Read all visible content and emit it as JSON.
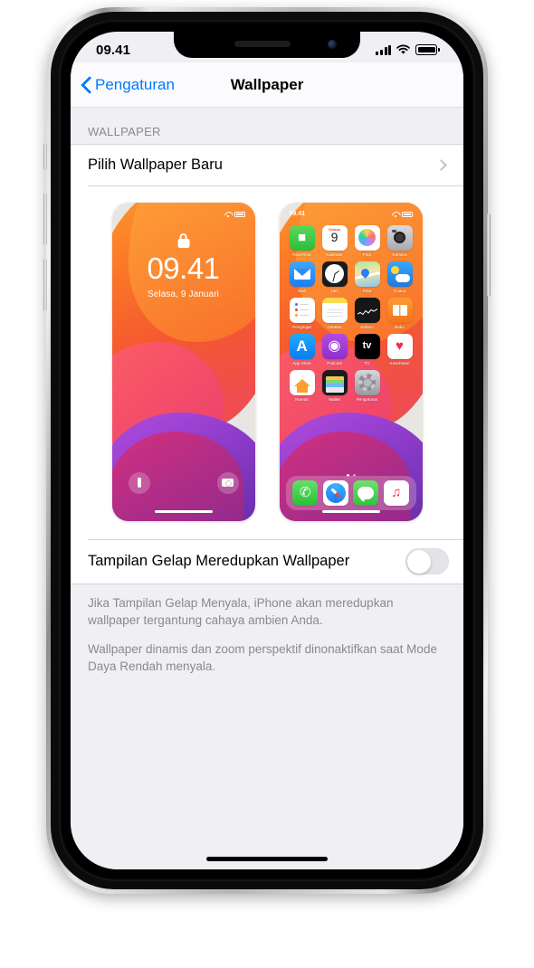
{
  "statusbar": {
    "time": "09.41",
    "signal_icon": "cellular-bars-icon",
    "wifi_icon": "wifi-icon",
    "battery_icon": "battery-icon"
  },
  "navbar": {
    "back_label": "Pengaturan",
    "title": "Wallpaper",
    "back_icon": "chevron-left-icon"
  },
  "section": {
    "header": "WALLPAPER"
  },
  "rows": {
    "choose_wallpaper": {
      "label": "Pilih Wallpaper Baru",
      "chevron_icon": "chevron-right-icon"
    },
    "dark_dim": {
      "label": "Tampilan Gelap Meredupkan Wallpaper",
      "toggle_state": "off"
    }
  },
  "footer": {
    "paragraph_1": "Jika Tampilan Gelap Menyala, iPhone akan meredupkan wallpaper tergantung cahaya ambien Anda.",
    "paragraph_2": "Wallpaper dinamis dan zoom perspektif dinonaktifkan saat Mode Daya Rendah menyala."
  },
  "lock_preview": {
    "lock_icon": "lock-icon",
    "time": "09.41",
    "date": "Selasa, 9 Januari",
    "flashlight_icon": "flashlight-icon",
    "camera_icon": "camera-icon",
    "mini_status": {
      "wifi_icon": "wifi-icon",
      "battery_icon": "battery-icon"
    }
  },
  "home_preview": {
    "mini_status": {
      "time": "09.41",
      "wifi_icon": "wifi-icon",
      "battery_icon": "battery-icon"
    },
    "calendar_weekday": "Selasa",
    "calendar_day": "9",
    "page_dots": 2,
    "active_dot": 1,
    "apps": [
      {
        "label": "FaceTime",
        "icon": "facetime-icon"
      },
      {
        "label": "Kalender",
        "icon": "calendar-icon"
      },
      {
        "label": "Foto",
        "icon": "photos-icon"
      },
      {
        "label": "Kamera",
        "icon": "camera-icon"
      },
      {
        "label": "Mail",
        "icon": "mail-icon"
      },
      {
        "label": "Jam",
        "icon": "clock-icon"
      },
      {
        "label": "Peta",
        "icon": "maps-icon"
      },
      {
        "label": "Cuaca",
        "icon": "weather-icon"
      },
      {
        "label": "Pengingat",
        "icon": "reminders-icon"
      },
      {
        "label": "Catatan",
        "icon": "notes-icon"
      },
      {
        "label": "Saham",
        "icon": "stocks-icon"
      },
      {
        "label": "Buku",
        "icon": "books-icon"
      },
      {
        "label": "App Store",
        "icon": "appstore-icon"
      },
      {
        "label": "Podcast",
        "icon": "podcasts-icon"
      },
      {
        "label": "TV",
        "icon": "tv-icon"
      },
      {
        "label": "Kesehatan",
        "icon": "health-icon"
      },
      {
        "label": "Rumah",
        "icon": "home-icon"
      },
      {
        "label": "Wallet",
        "icon": "wallet-icon"
      },
      {
        "label": "Pengaturan",
        "icon": "settings-icon"
      }
    ],
    "dock": [
      {
        "label": "Telepon",
        "icon": "phone-icon"
      },
      {
        "label": "Safari",
        "icon": "safari-icon"
      },
      {
        "label": "Pesan",
        "icon": "messages-icon"
      },
      {
        "label": "Musik",
        "icon": "music-icon"
      }
    ]
  },
  "colors": {
    "accent": "#007aff",
    "screen_bg": "#efeff4",
    "group_bg": "#ffffff",
    "secondary_text": "#8a8a8e"
  }
}
